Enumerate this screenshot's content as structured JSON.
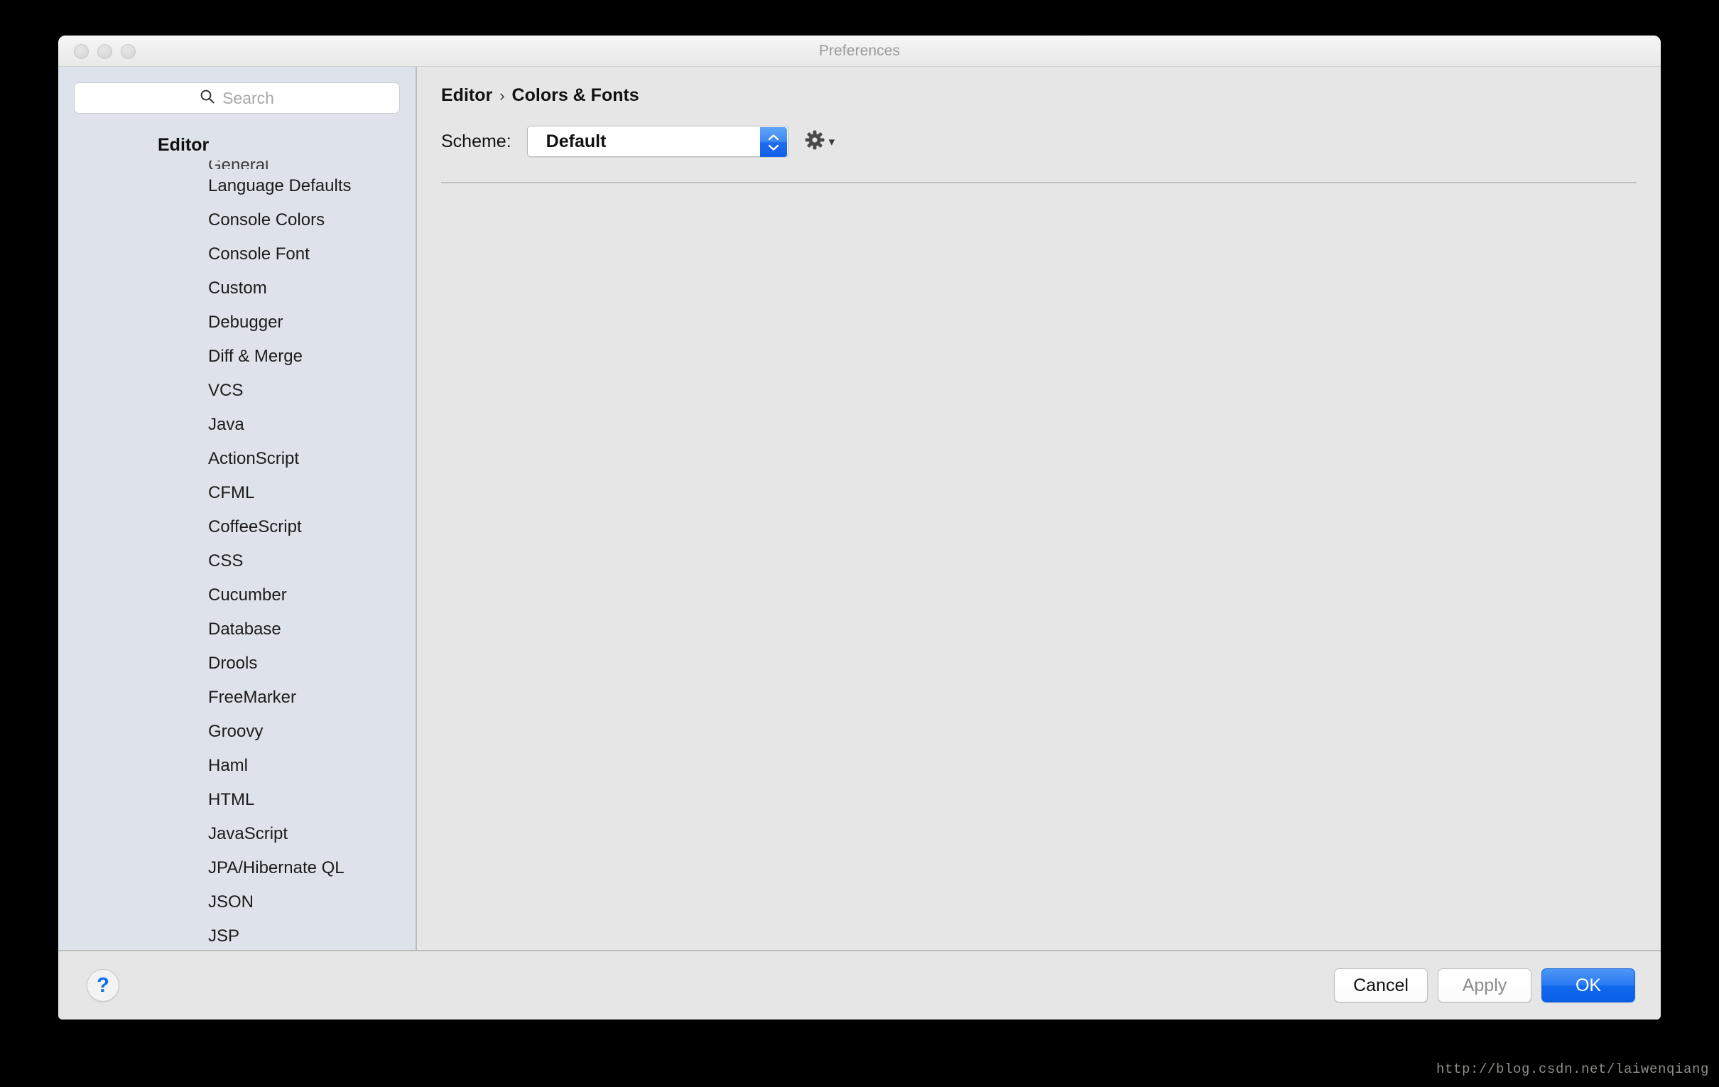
{
  "window": {
    "title": "Preferences",
    "traffic_lights": [
      "close",
      "minimize",
      "zoom"
    ]
  },
  "sidebar": {
    "search": {
      "placeholder": "Search",
      "value": "",
      "icon": "search-icon"
    },
    "group_header": "Editor",
    "items": [
      {
        "label": "General",
        "clipped": true
      },
      {
        "label": "Language Defaults",
        "clipped": false
      },
      {
        "label": "Console Colors",
        "clipped": false
      },
      {
        "label": "Console Font",
        "clipped": false
      },
      {
        "label": "Custom",
        "clipped": false
      },
      {
        "label": "Debugger",
        "clipped": false
      },
      {
        "label": "Diff & Merge",
        "clipped": false
      },
      {
        "label": "VCS",
        "clipped": false
      },
      {
        "label": "Java",
        "clipped": false
      },
      {
        "label": "ActionScript",
        "clipped": false
      },
      {
        "label": "CFML",
        "clipped": false
      },
      {
        "label": "CoffeeScript",
        "clipped": false
      },
      {
        "label": "CSS",
        "clipped": false
      },
      {
        "label": "Cucumber",
        "clipped": false
      },
      {
        "label": "Database",
        "clipped": false
      },
      {
        "label": "Drools",
        "clipped": false
      },
      {
        "label": "FreeMarker",
        "clipped": false
      },
      {
        "label": "Groovy",
        "clipped": false
      },
      {
        "label": "Haml",
        "clipped": false
      },
      {
        "label": "HTML",
        "clipped": false
      },
      {
        "label": "JavaScript",
        "clipped": false
      },
      {
        "label": "JPA/Hibernate QL",
        "clipped": false
      },
      {
        "label": "JSON",
        "clipped": false
      },
      {
        "label": "JSP",
        "clipped": false
      }
    ]
  },
  "content": {
    "breadcrumb": {
      "root": "Editor",
      "separator": "›",
      "leaf": "Colors & Fonts"
    },
    "scheme": {
      "label": "Scheme:",
      "selected": "Default",
      "options": [
        "Default"
      ],
      "gear_icon": "gear-icon",
      "gear_caret": "▾"
    }
  },
  "footer": {
    "help_label": "?",
    "cancel_label": "Cancel",
    "apply_label": "Apply",
    "apply_enabled": false,
    "ok_label": "OK"
  },
  "watermark": "http://blog.csdn.net/laiwenqiang",
  "colors": {
    "sidebar_bg": "#dee2eb",
    "content_bg": "#e6e6e6",
    "titlebar_bg": "#eeeeee",
    "accent_blue": "#1169ee",
    "help_blue": "#0a6cf0",
    "placeholder_gray": "#a8a8a8",
    "title_gray": "#9a9a9a",
    "divider_gray": "#bdbdbd"
  }
}
